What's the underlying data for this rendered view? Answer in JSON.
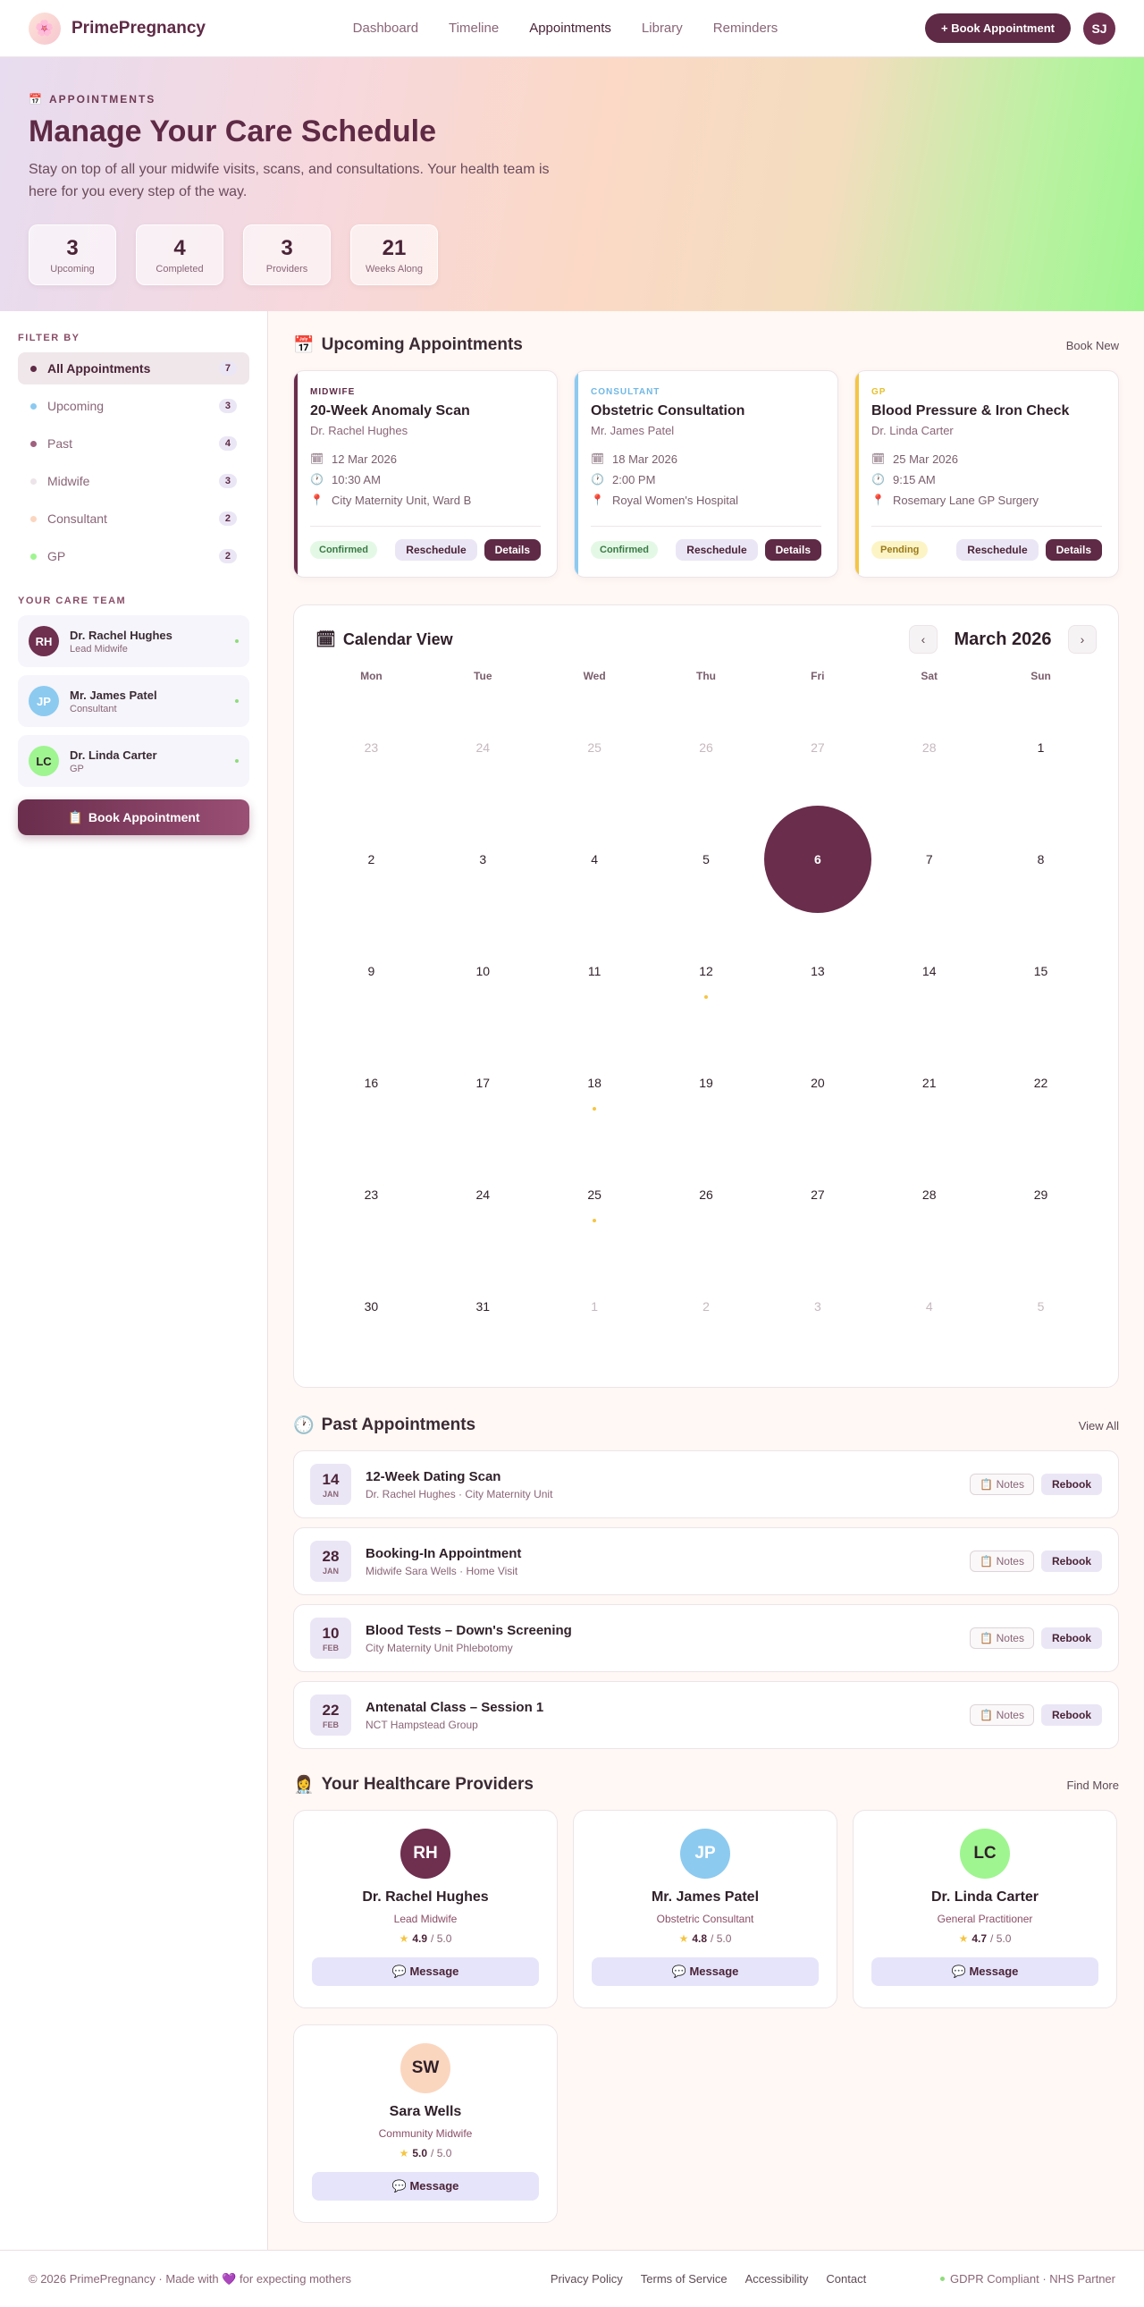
{
  "header": {
    "brand": "PrimePregnancy",
    "brand_icon": "🌸",
    "nav": [
      "Dashboard",
      "Timeline",
      "Appointments",
      "Library",
      "Reminders"
    ],
    "nav_active": "Appointments",
    "book_button": "+ Book Appointment",
    "user_initials": "SJ"
  },
  "hero": {
    "kicker_icon": "📅",
    "kicker": "APPOINTMENTS",
    "title": "Manage Your Care Schedule",
    "subtitle": "Stay on top of all your midwife visits, scans, and consultations. Your health team is here for you every step of the way.",
    "stats": [
      {
        "value": "3",
        "label": "Upcoming"
      },
      {
        "value": "4",
        "label": "Completed"
      },
      {
        "value": "3",
        "label": "Providers"
      },
      {
        "value": "21",
        "label": "Weeks Along"
      }
    ]
  },
  "sidebar": {
    "filter_heading": "FILTER BY",
    "filters": [
      {
        "label": "All Appointments",
        "count": "7",
        "color": "#5e2a45",
        "active": true
      },
      {
        "label": "Upcoming",
        "count": "3",
        "color": "#8ccaf0"
      },
      {
        "label": "Past",
        "count": "4",
        "color": "#a0607e"
      },
      {
        "label": "Midwife",
        "count": "3",
        "color": "#ece4e8"
      },
      {
        "label": "Consultant",
        "count": "2",
        "color": "#fbd6bf"
      },
      {
        "label": "GP",
        "count": "2",
        "color": "#9ff590"
      }
    ],
    "team_heading": "YOUR CARE TEAM",
    "team": [
      {
        "initials": "RH",
        "name": "Dr. Rachel Hughes",
        "role": "Lead Midwife",
        "bg": "#6f2f4f",
        "fg": "#ffffff"
      },
      {
        "initials": "JP",
        "name": "Mr. James Patel",
        "role": "Consultant",
        "bg": "#8ccaf0",
        "fg": "#ffffff"
      },
      {
        "initials": "LC",
        "name": "Dr. Linda Carter",
        "role": "GP",
        "bg": "#9ff590",
        "fg": "#2f1f28"
      }
    ],
    "book_icon": "📋",
    "book_label": "Book Appointment"
  },
  "upcoming": {
    "title_icon": "📅",
    "title": "Upcoming Appointments",
    "link": "Book New",
    "cards": [
      {
        "type": "MIDWIFE",
        "type_color": "#5e2a45",
        "stripe": "#6a2d4c",
        "title": "20-Week Anomaly Scan",
        "doctor": "Dr. Rachel Hughes",
        "date": "12 Mar 2026",
        "time": "10:30 AM",
        "location": "City Maternity Unit, Ward B",
        "status": "Confirmed",
        "status_kind": "confirmed",
        "reschedule": "Reschedule",
        "details": "Details"
      },
      {
        "type": "CONSULTANT",
        "type_color": "#6fb8e6",
        "stripe": "#8ccaf0",
        "title": "Obstetric Consultation",
        "doctor": "Mr. James Patel",
        "date": "18 Mar 2026",
        "time": "2:00 PM",
        "location": "Royal Women's Hospital",
        "status": "Confirmed",
        "status_kind": "confirmed",
        "reschedule": "Reschedule",
        "details": "Details"
      },
      {
        "type": "GP",
        "type_color": "#e6c02e",
        "stripe": "#f5c542",
        "title": "Blood Pressure & Iron Check",
        "doctor": "Dr. Linda Carter",
        "date": "25 Mar 2026",
        "time": "9:15 AM",
        "location": "Rosemary Lane GP Surgery",
        "status": "Pending",
        "status_kind": "pending",
        "reschedule": "Reschedule",
        "details": "Details"
      }
    ],
    "icons": {
      "date": "calendar-icon",
      "time": "clock-icon",
      "location": "pin-icon"
    }
  },
  "calendar": {
    "title_icon": "🗓",
    "title": "Calendar View",
    "month": "March 2026",
    "prev": "‹",
    "next": "›",
    "weekdays": [
      "Mon",
      "Tue",
      "Wed",
      "Thu",
      "Fri",
      "Sat",
      "Sun"
    ],
    "days": [
      {
        "n": "23",
        "muted": true
      },
      {
        "n": "24",
        "muted": true
      },
      {
        "n": "25",
        "muted": true
      },
      {
        "n": "26",
        "muted": true
      },
      {
        "n": "27",
        "muted": true
      },
      {
        "n": "28",
        "muted": true
      },
      {
        "n": "1"
      },
      {
        "n": "2"
      },
      {
        "n": "3"
      },
      {
        "n": "4"
      },
      {
        "n": "5"
      },
      {
        "n": "6",
        "today": true
      },
      {
        "n": "7"
      },
      {
        "n": "8"
      },
      {
        "n": "9"
      },
      {
        "n": "10"
      },
      {
        "n": "11"
      },
      {
        "n": "12",
        "event": true
      },
      {
        "n": "13"
      },
      {
        "n": "14"
      },
      {
        "n": "15"
      },
      {
        "n": "16"
      },
      {
        "n": "17"
      },
      {
        "n": "18",
        "event": true
      },
      {
        "n": "19"
      },
      {
        "n": "20"
      },
      {
        "n": "21"
      },
      {
        "n": "22"
      },
      {
        "n": "23"
      },
      {
        "n": "24"
      },
      {
        "n": "25",
        "event": true
      },
      {
        "n": "26"
      },
      {
        "n": "27"
      },
      {
        "n": "28"
      },
      {
        "n": "29"
      },
      {
        "n": "30"
      },
      {
        "n": "31"
      },
      {
        "n": "1",
        "muted": true
      },
      {
        "n": "2",
        "muted": true
      },
      {
        "n": "3",
        "muted": true
      },
      {
        "n": "4",
        "muted": true
      },
      {
        "n": "5",
        "muted": true
      }
    ]
  },
  "past": {
    "title_icon": "🕐",
    "title": "Past Appointments",
    "link": "View All",
    "notes_label": "📋 Notes",
    "rebook_label": "Rebook",
    "items": [
      {
        "day": "14",
        "month": "JAN",
        "title": "12-Week Dating Scan",
        "sub": "Dr. Rachel Hughes · City Maternity Unit"
      },
      {
        "day": "28",
        "month": "JAN",
        "title": "Booking-In Appointment",
        "sub": "Midwife Sara Wells · Home Visit"
      },
      {
        "day": "10",
        "month": "FEB",
        "title": "Blood Tests – Down's Screening",
        "sub": "City Maternity Unit Phlebotomy"
      },
      {
        "day": "22",
        "month": "FEB",
        "title": "Antenatal Class – Session 1",
        "sub": "NCT Hampstead Group"
      }
    ]
  },
  "providers": {
    "title_icon": "👩‍⚕️",
    "title": "Your Healthcare Providers",
    "link": "Find More",
    "message_label": "💬 Message",
    "star": "★",
    "items": [
      {
        "initials": "RH",
        "name": "Dr. Rachel Hughes",
        "role": "Lead Midwife",
        "rating": "4.9",
        "out_of": "/ 5.0",
        "bg": "#6f2f4f",
        "fg": "#ffffff"
      },
      {
        "initials": "JP",
        "name": "Mr. James Patel",
        "role": "Obstetric Consultant",
        "rating": "4.8",
        "out_of": "/ 5.0",
        "bg": "#8ccaf0",
        "fg": "#ffffff"
      },
      {
        "initials": "LC",
        "name": "Dr. Linda Carter",
        "role": "General Practitioner",
        "rating": "4.7",
        "out_of": "/ 5.0",
        "bg": "#9ff590",
        "fg": "#2f1f28"
      },
      {
        "initials": "SW",
        "name": "Sara Wells",
        "role": "Community Midwife",
        "rating": "5.0",
        "out_of": "/ 5.0",
        "bg": "#fbd6bf",
        "fg": "#2f1f28"
      }
    ]
  },
  "footer": {
    "copyright": "© 2026 PrimePregnancy · Made with 💜 for expecting mothers",
    "links": [
      "Privacy Policy",
      "Terms of Service",
      "Accessibility",
      "Contact"
    ],
    "badge": "GDPR Compliant · NHS Partner"
  }
}
